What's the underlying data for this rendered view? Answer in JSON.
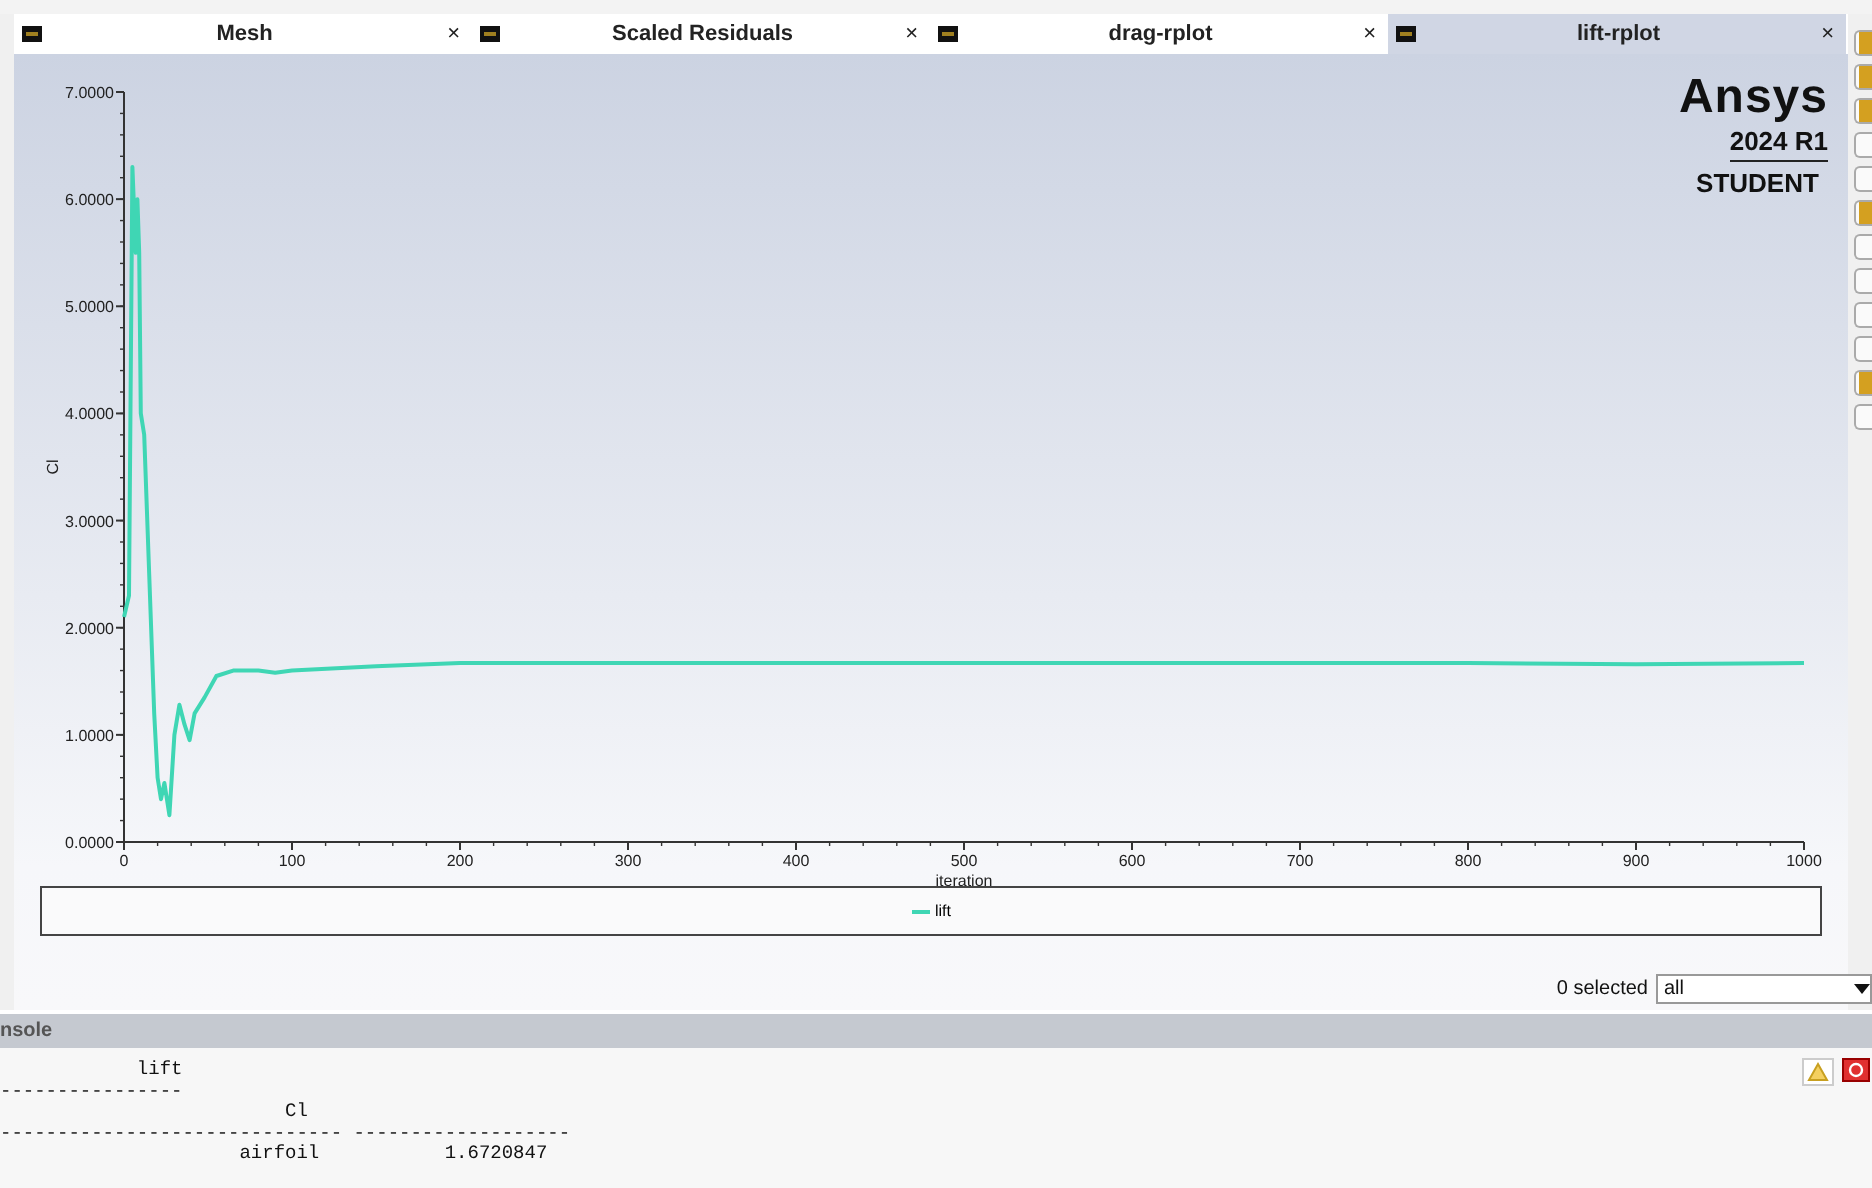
{
  "tabs": [
    {
      "label": "Mesh",
      "close": "×",
      "selected": false
    },
    {
      "label": "Scaled Residuals",
      "close": "×",
      "selected": false
    },
    {
      "label": "drag-rplot",
      "close": "×",
      "selected": false
    },
    {
      "label": "lift-rplot",
      "close": "×",
      "selected": true
    }
  ],
  "logo": {
    "name": "Ansys",
    "version": "2024 R1",
    "edition": "STUDENT"
  },
  "chart": {
    "chart_data": {
      "type": "line",
      "xlabel": "iteration",
      "ylabel": "Cl",
      "xlim": [
        0,
        1000
      ],
      "ylim": [
        0,
        7
      ],
      "xticks": [
        0,
        100,
        200,
        300,
        400,
        500,
        600,
        700,
        800,
        900,
        1000
      ],
      "yticks": [
        {
          "value": 0,
          "label": "0.0000"
        },
        {
          "value": 1,
          "label": "1.0000"
        },
        {
          "value": 2,
          "label": "2.0000"
        },
        {
          "value": 3,
          "label": "3.0000"
        },
        {
          "value": 4,
          "label": "4.0000"
        },
        {
          "value": 5,
          "label": "5.0000"
        },
        {
          "value": 6,
          "label": "6.0000"
        },
        {
          "value": 7,
          "label": "7.0000"
        }
      ],
      "x": [
        0,
        3,
        5,
        7,
        8,
        9,
        10,
        12,
        15,
        18,
        20,
        22,
        24,
        27,
        30,
        33,
        36,
        39,
        42,
        48,
        55,
        65,
        80,
        90,
        100,
        150,
        200,
        300,
        400,
        500,
        600,
        700,
        800,
        900,
        1000
      ],
      "series": [
        {
          "name": "lift",
          "color": "#3fd6b4",
          "values": [
            2.1,
            2.3,
            6.3,
            5.5,
            6.0,
            5.5,
            4.0,
            3.8,
            2.5,
            1.2,
            0.6,
            0.4,
            0.55,
            0.25,
            1.0,
            1.28,
            1.1,
            0.95,
            1.2,
            1.35,
            1.55,
            1.6,
            1.6,
            1.58,
            1.6,
            1.64,
            1.67,
            1.67,
            1.67,
            1.67,
            1.67,
            1.67,
            1.67,
            1.66,
            1.67
          ]
        }
      ]
    }
  },
  "selection": {
    "count_label": "0 selected",
    "filter": "all"
  },
  "console": {
    "title": "nsole",
    "lines": [
      "            lift",
      "----------------",
      "                         Cl",
      "------------------------------ -------------------",
      "                     airfoil           1.6720847"
    ]
  }
}
